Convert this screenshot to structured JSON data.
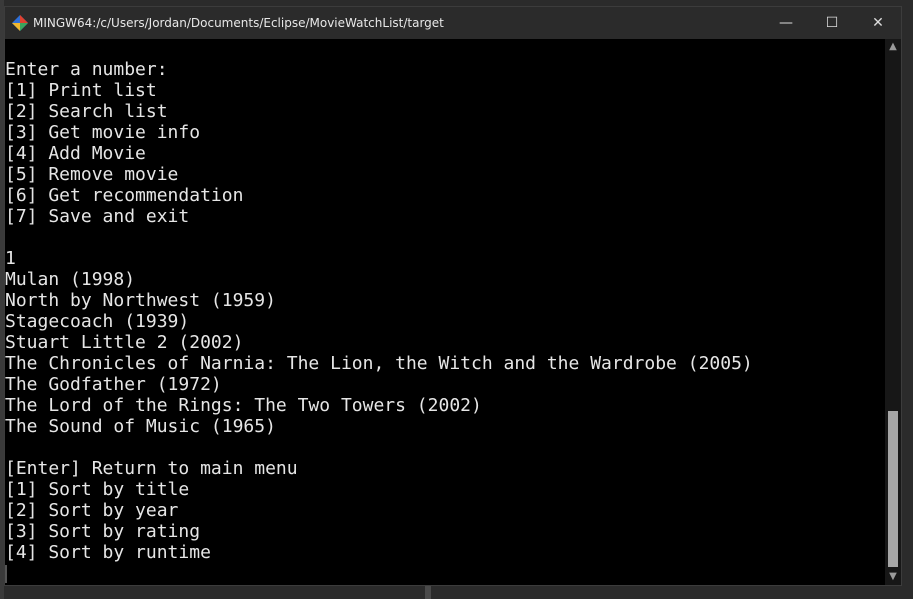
{
  "window": {
    "title": "MINGW64:/c/Users/Jordan/Documents/Eclipse/MovieWatchList/target",
    "minimize_glyph": "—",
    "maximize_glyph": "☐",
    "close_glyph": "✕",
    "icon": "mingw-icon"
  },
  "terminal": {
    "lines": [
      "Enter a number:",
      "[1] Print list",
      "[2] Search list",
      "[3] Get movie info",
      "[4] Add Movie",
      "[5] Remove movie",
      "[6] Get recommendation",
      "[7] Save and exit",
      "",
      "1",
      "Mulan (1998)",
      "North by Northwest (1959)",
      "Stagecoach (1939)",
      "Stuart Little 2 (2002)",
      "The Chronicles of Narnia: The Lion, the Witch and the Wardrobe (2005)",
      "The Godfather (1972)",
      "The Lord of the Rings: The Two Towers (2002)",
      "The Sound of Music (1965)",
      "",
      "[Enter] Return to main menu",
      "[1] Sort by title",
      "[2] Sort by year",
      "[3] Sort by rating",
      "[4] Sort by runtime"
    ]
  },
  "scrollbar": {
    "up_glyph": "▲",
    "down_glyph": "▼",
    "position_fraction": 0.68
  }
}
